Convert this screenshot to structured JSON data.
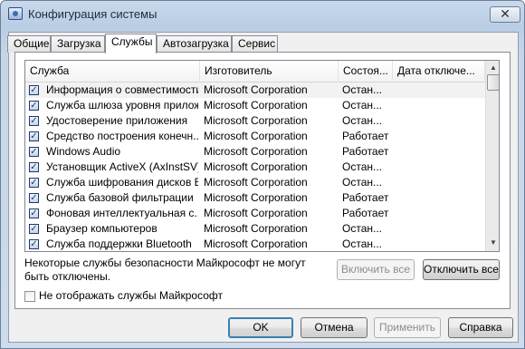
{
  "window": {
    "title": "Конфигурация системы",
    "close_label": "✕"
  },
  "tabs": [
    {
      "label": "Общие"
    },
    {
      "label": "Загрузка"
    },
    {
      "label": "Службы"
    },
    {
      "label": "Автозагрузка"
    },
    {
      "label": "Сервис"
    }
  ],
  "services": {
    "columns": [
      "Служба",
      "Изготовитель",
      "Состоя...",
      "Дата отключе..."
    ],
    "rows": [
      {
        "name": "Информация о совместимости ...",
        "vendor": "Microsoft Corporation",
        "status": "Остан...",
        "date": ""
      },
      {
        "name": "Служба шлюза уровня прилож...",
        "vendor": "Microsoft Corporation",
        "status": "Остан...",
        "date": ""
      },
      {
        "name": "Удостоверение приложения",
        "vendor": "Microsoft Corporation",
        "status": "Остан...",
        "date": ""
      },
      {
        "name": "Средство построения конечн...",
        "vendor": "Microsoft Corporation",
        "status": "Работает",
        "date": ""
      },
      {
        "name": "Windows Audio",
        "vendor": "Microsoft Corporation",
        "status": "Работает",
        "date": ""
      },
      {
        "name": "Установщик ActiveX (AxInstSV)",
        "vendor": "Microsoft Corporation",
        "status": "Остан...",
        "date": ""
      },
      {
        "name": "Служба шифрования дисков Bi...",
        "vendor": "Microsoft Corporation",
        "status": "Остан...",
        "date": ""
      },
      {
        "name": "Служба базовой фильтрации",
        "vendor": "Microsoft Corporation",
        "status": "Работает",
        "date": ""
      },
      {
        "name": "Фоновая интеллектуальная с...",
        "vendor": "Microsoft Corporation",
        "status": "Работает",
        "date": ""
      },
      {
        "name": "Браузер компьютеров",
        "vendor": "Microsoft Corporation",
        "status": "Остан...",
        "date": ""
      },
      {
        "name": "Служба поддержки Bluetooth",
        "vendor": "Microsoft Corporation",
        "status": "Остан...",
        "date": ""
      }
    ],
    "check_mark": "✓"
  },
  "note": "Некоторые службы безопасности Майкрософт не могут быть отключены.",
  "buttons": {
    "enable_all": "Включить все",
    "disable_all": "Отключить все",
    "ok": "OK",
    "cancel": "Отмена",
    "apply": "Применить",
    "help": "Справка"
  },
  "hide_ms_label": "Не отображать службы Майкрософт",
  "scrollbar": {
    "up_glyph": "▲",
    "down_glyph": "▼"
  }
}
